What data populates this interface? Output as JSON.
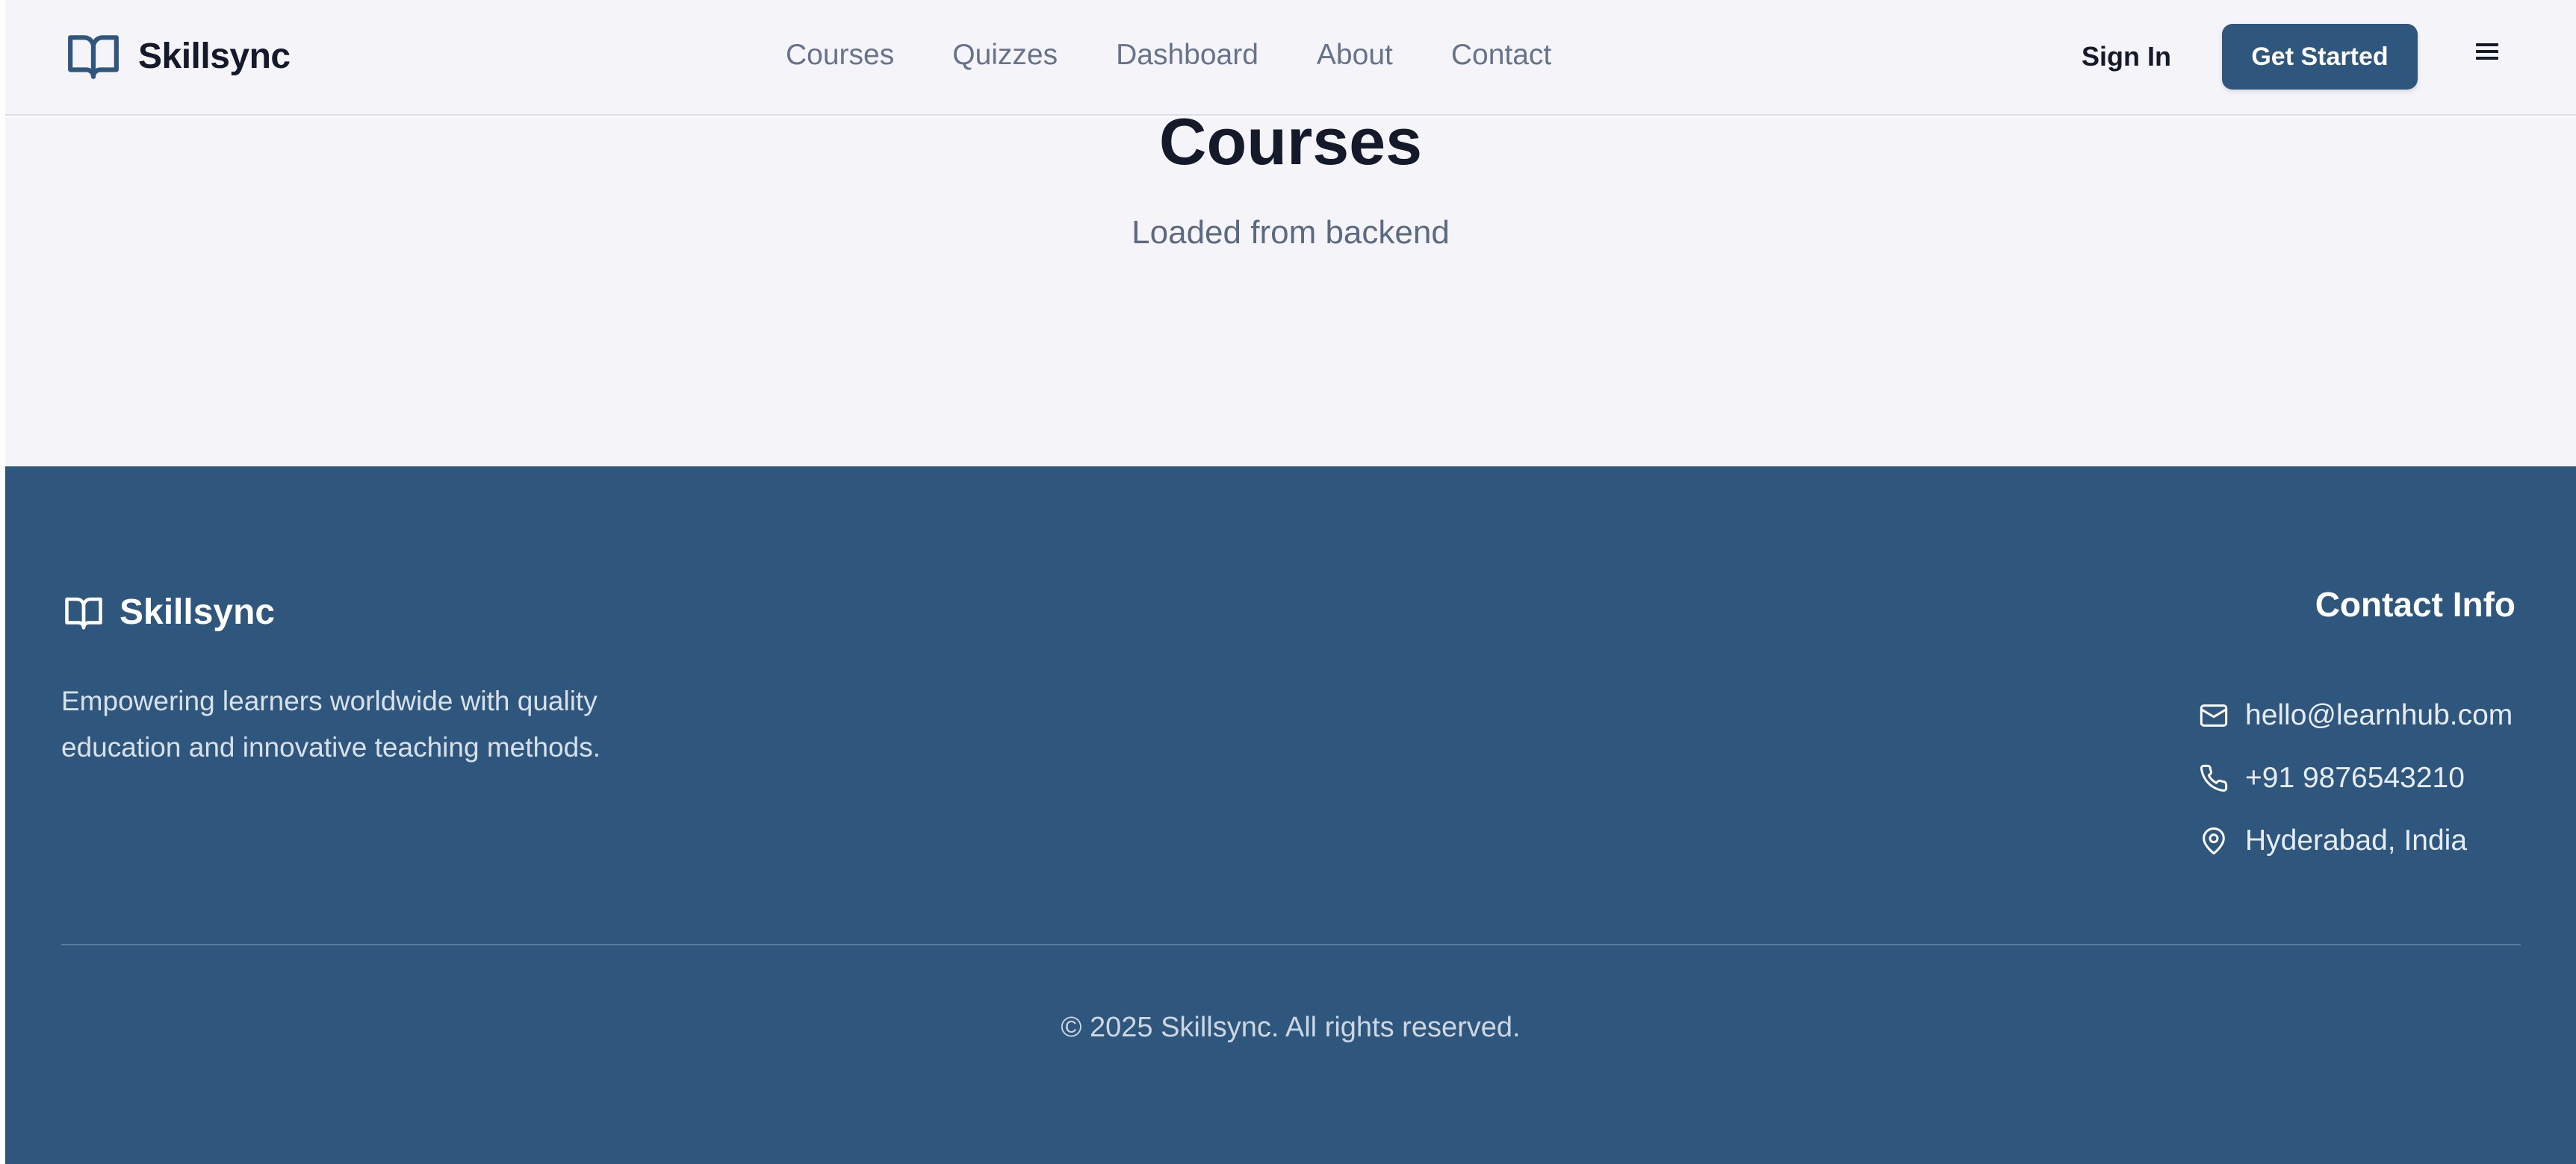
{
  "brand": {
    "name": "Skillsync",
    "icon": "open-book-icon"
  },
  "nav": {
    "links": [
      "Courses",
      "Quizzes",
      "Dashboard",
      "About",
      "Contact"
    ]
  },
  "header_actions": {
    "sign_in": "Sign In",
    "get_started": "Get Started",
    "menu_icon": "hamburger-menu-icon"
  },
  "main": {
    "title": "Courses",
    "subtitle": "Loaded from backend"
  },
  "footer": {
    "brand": "Skillsync",
    "tagline_line1": "Empowering learners worldwide with quality",
    "tagline_line2": "education and innovative teaching methods.",
    "contact_title": "Contact Info",
    "contacts": [
      {
        "icon": "mail-icon",
        "text": "hello@learnhub.com"
      },
      {
        "icon": "phone-icon",
        "text": "+91 9876543210"
      },
      {
        "icon": "location-pin-icon",
        "text": "Hyderabad, India"
      }
    ],
    "copyright": "© 2025 Skillsync. All rights reserved."
  },
  "colors": {
    "primary": "#2f567d",
    "background": "#f5f5f9",
    "text_dark": "#141a2a",
    "text_muted": "#66738a"
  }
}
